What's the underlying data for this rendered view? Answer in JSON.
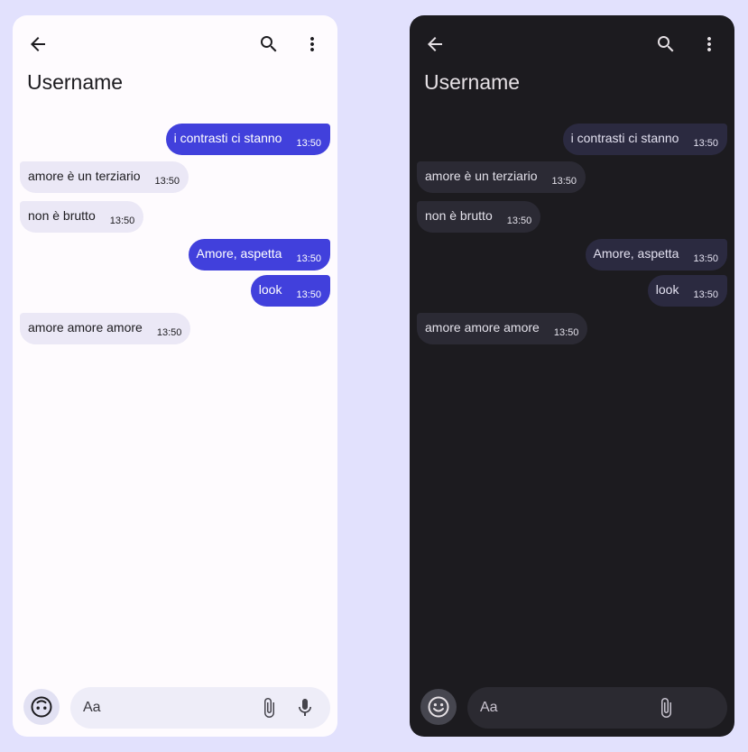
{
  "header": {
    "title": "Username"
  },
  "messages": [
    {
      "direction": "out",
      "text": "i contrasti ci stanno",
      "time": "13:50"
    },
    {
      "direction": "in",
      "text": "amore è un terziario",
      "time": "13:50"
    },
    {
      "direction": "in",
      "text": "non è brutto",
      "time": "13:50"
    },
    {
      "direction": "out",
      "text": "Amore, aspetta",
      "time": "13:50"
    },
    {
      "direction": "out",
      "text": "look",
      "time": "13:50"
    },
    {
      "direction": "in",
      "text": "amore amore amore",
      "time": "13:50"
    }
  ],
  "composer": {
    "placeholder": "Aa"
  },
  "icons": {
    "back": "arrow-back-icon",
    "search": "search-icon",
    "more": "more-vert-icon",
    "emoji": "emoji-icon",
    "attach": "attach-icon",
    "mic": "mic-icon"
  },
  "themes": {
    "light": {
      "surface": "#fefbfe",
      "outgoing_bubble": "#4140dc",
      "incoming_bubble": "#ebe8f6"
    },
    "dark": {
      "surface": "#1c1b1f",
      "outgoing_bubble": "#2b2a40",
      "incoming_bubble": "#2b2a34"
    }
  }
}
